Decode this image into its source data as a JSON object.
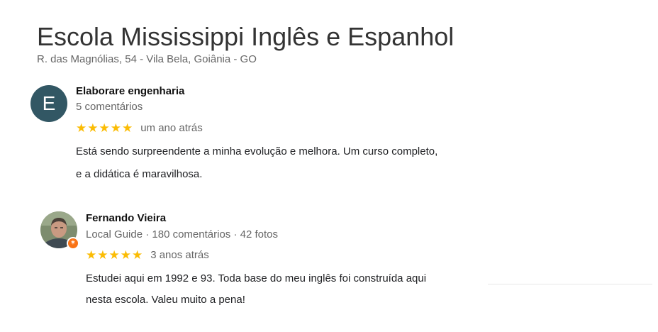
{
  "place": {
    "title": "Escola Mississippi Inglês e Espanhol",
    "address": "R. das Magnólias, 54 - Vila Bela, Goiânia - GO"
  },
  "reviews": [
    {
      "avatar_letter": "E",
      "avatar_color": "#325764",
      "name": "Elaborare engenharia",
      "meta": "5 comentários",
      "rating": 5,
      "stars": "★★★★★",
      "date": "um ano atrás",
      "text_lines": [
        "Está sendo surpreendente a minha evolução e melhora. Um curso completo,",
        "e a didática é maravilhosa."
      ]
    },
    {
      "avatar_icon": "profile-photo",
      "badge_icon": "local-guide-star-icon",
      "badge_glyph": "✶",
      "name": "Fernando Vieira",
      "meta": "Local Guide · 180 comentários · 42 fotos",
      "rating": 5,
      "stars": "★★★★★",
      "date": "3 anos atrás",
      "text_lines": [
        "Estudei aqui em 1992 e 93. Toda base do meu inglês foi construída aqui",
        "nesta escola. Valeu muito a  pena!"
      ]
    }
  ],
  "colors": {
    "star": "#fbbc04",
    "badge": "#f97316",
    "secondary_text": "#666666"
  }
}
